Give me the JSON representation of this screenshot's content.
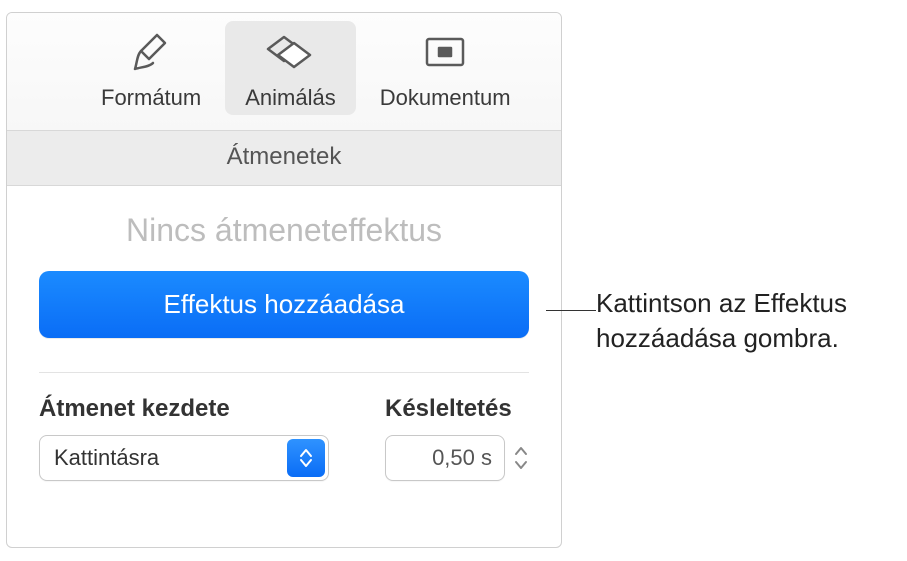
{
  "toolbar": {
    "format": "Formátum",
    "animate": "Animálás",
    "document": "Dokumentum"
  },
  "section_header": "Átmenetek",
  "placeholder_title": "Nincs átmeneteffektus",
  "add_effect_label": "Effektus hozzáadása",
  "transition_start": {
    "label": "Átmenet kezdete",
    "value": "Kattintásra"
  },
  "delay": {
    "label": "Késleltetés",
    "value": "0,50 s"
  },
  "callout": "Kattintson az Effektus hozzáadása gombra."
}
